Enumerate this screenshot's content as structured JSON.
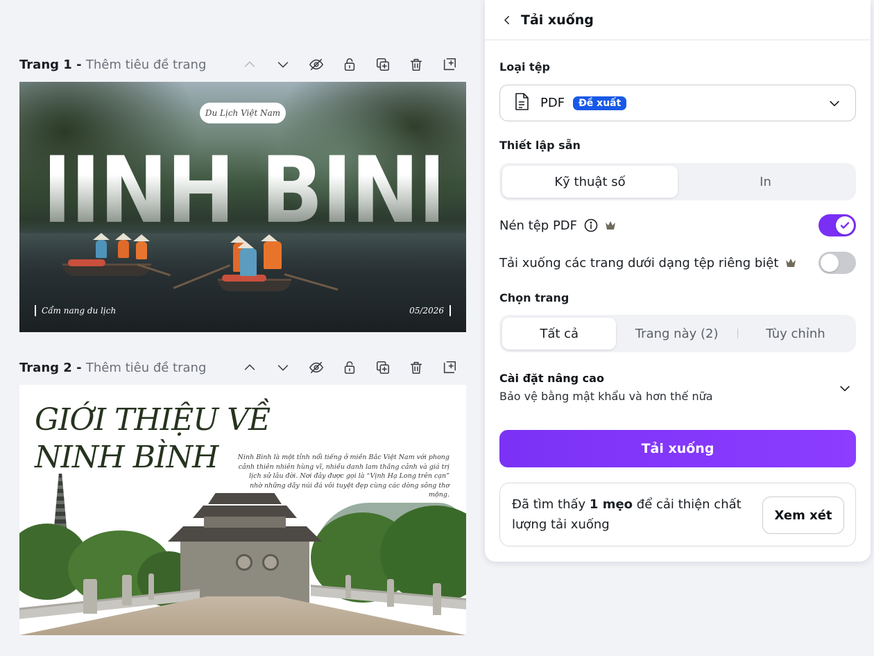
{
  "pages": [
    {
      "name": "Trang 1 -",
      "title_placeholder": "Thêm tiêu đề trang"
    },
    {
      "name": "Trang 2 -",
      "title_placeholder": "Thêm tiêu đề trang"
    }
  ],
  "slide1": {
    "badge": "Du Lịch Việt Nam",
    "headline": "NINH BÌNH",
    "footer_left": "Cẩm nang du lịch",
    "footer_right": "05/2026"
  },
  "slide2": {
    "title_line1": "GIỚI THIỆU VỀ",
    "title_line2": "NINH BÌNH",
    "description": "Ninh Bình là một tỉnh nổi tiếng ở miền Bắc Việt Nam với phong cảnh thiên nhiên hùng vĩ, nhiều danh lam thắng cảnh và giá trị lịch sử lâu đời. Nơi đây được gọi là “Vịnh Hạ Long trên cạn” nhờ những dãy núi đá vôi tuyệt đẹp cùng các dòng sông thơ mộng."
  },
  "panel": {
    "title": "Tải xuống",
    "file_type_label": "Loại tệp",
    "file_type_value": "PDF",
    "file_type_badge": "Đề xuất",
    "preset_label": "Thiết lập sẵn",
    "preset_options": [
      "Kỹ thuật số",
      "In"
    ],
    "compress_label": "Nén tệp PDF",
    "compress_on": true,
    "separate_label": "Tải xuống các trang dưới dạng tệp riêng biệt",
    "separate_on": false,
    "pages_label": "Chọn trang",
    "pages_options": [
      "Tất cả",
      "Trang này (2)",
      "Tùy chỉnh"
    ],
    "advanced_title": "Cài đặt nâng cao",
    "advanced_sub": "Bảo vệ bằng mật khẩu và hơn thế nữa",
    "download_button": "Tải xuống",
    "tip_prefix": "Đã tìm thấy",
    "tip_bold": "1 mẹo",
    "tip_suffix": "để cải thiện chất lượng tải xuống",
    "review_button": "Xem xét"
  },
  "colors": {
    "accent": "#7a2ff5",
    "badge": "#1859e8"
  }
}
